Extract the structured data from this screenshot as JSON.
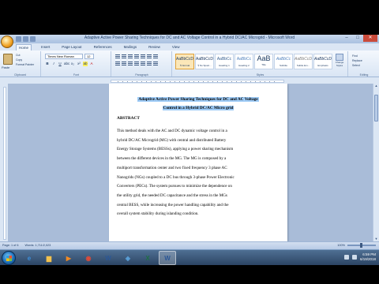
{
  "window": {
    "title": "Adaptive Active Power Sharing Techniques for DC and AC Voltage Control in a Hybrid DC/AC Microgrid - Microsoft Word",
    "controls": {
      "minimize": "–",
      "maximize": "□",
      "close": "✕"
    }
  },
  "tabs": [
    {
      "label": "Home",
      "active": true
    },
    {
      "label": "Insert",
      "active": false
    },
    {
      "label": "Page Layout",
      "active": false
    },
    {
      "label": "References",
      "active": false
    },
    {
      "label": "Mailings",
      "active": false
    },
    {
      "label": "Review",
      "active": false
    },
    {
      "label": "View",
      "active": false
    }
  ],
  "ribbon": {
    "clipboard": {
      "paste": "Paste",
      "cut": "Cut",
      "copy": "Copy",
      "format_painter": "Format Painter",
      "label": "Clipboard"
    },
    "font": {
      "name": "Times New Roman",
      "size": "12",
      "bold": "B",
      "italic": "I",
      "underline": "U",
      "label": "Font"
    },
    "paragraph": {
      "label": "Paragraph"
    },
    "styles": {
      "label": "Styles",
      "items": [
        {
          "sample": "AaBbCcDc",
          "name": "¶ Normal",
          "selected": true
        },
        {
          "sample": "AaBbCcDc",
          "name": "¶ No Spaci...",
          "selected": false
        },
        {
          "sample": "AaBbCc",
          "name": "Heading 1",
          "selected": false
        },
        {
          "sample": "AaBbCc",
          "name": "Heading 2",
          "selected": false
        },
        {
          "sample": "AaB",
          "name": "Title",
          "selected": false
        },
        {
          "sample": "AaBbCc",
          "name": "Subtitle",
          "selected": false
        },
        {
          "sample": "AaBbCcDc",
          "name": "Subtle Em...",
          "selected": false
        },
        {
          "sample": "AaBbCcDc",
          "name": "Emphasis",
          "selected": false
        }
      ],
      "change_styles": "Change Styles"
    },
    "editing": {
      "find": "Find",
      "replace": "Replace",
      "select": "Select",
      "label": "Editing"
    }
  },
  "document": {
    "title_line1": "Adaptive Active Power Sharing Techniques for DC and AC Voltage",
    "title_line2": "Control in a Hybrid DC/AC Micro grid",
    "abstract_heading": "ABSTRACT",
    "abstract_lines": [
      "This method deals with the AC and DC dynamic voltage control in a",
      "hybrid DC/AC Microgrid (MG) with central and distributed Battery",
      "Energy Storage Systems (BESSs), applying a power sharing mechanism",
      "between the different devices in the MG. The MG is composed by a",
      "multiport transformation center and two fixed frequency 3 phase AC",
      "Nanogrids (NGs) coupled to a DC bus through 3-phase Power Electronic",
      "Converters (PECs). The system pursues to minimize the dependence on",
      "the utility grid, the needed DC capacitance and the stress in the MGs",
      "central BESS, while increasing the power handling capability and the",
      "overall system stability during islanding condition."
    ]
  },
  "statusbar": {
    "page": "Page: 1 of 6",
    "words": "Words: 1,711/2,023",
    "zoom": "100%"
  },
  "taskbar": {
    "icons": [
      {
        "name": "ie-icon",
        "glyph": "e",
        "color": "#3b8fdc"
      },
      {
        "name": "folder-icon",
        "glyph": "▆",
        "color": "#f2c14e"
      },
      {
        "name": "media-player-icon",
        "glyph": "▶",
        "color": "#f08a24"
      },
      {
        "name": "chrome-icon",
        "glyph": "◉",
        "color": "#dd4b39"
      },
      {
        "name": "word-icon",
        "glyph": "W",
        "color": "#2b5797"
      },
      {
        "name": "app-icon",
        "glyph": "◈",
        "color": "#5aa0d8"
      },
      {
        "name": "excel-icon",
        "glyph": "X",
        "color": "#1e7145"
      },
      {
        "name": "word-active-icon",
        "glyph": "W",
        "color": "#2b5797"
      }
    ],
    "time": "6:59 PM",
    "date": "6/19/2018"
  }
}
